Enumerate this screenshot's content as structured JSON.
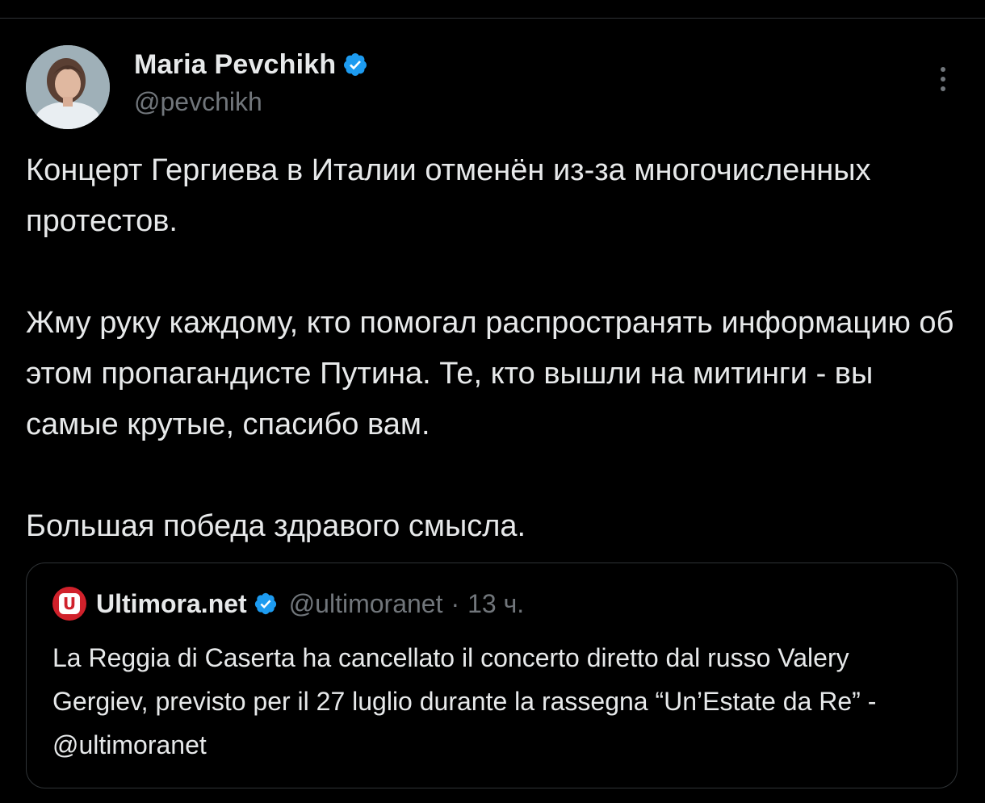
{
  "author": {
    "name": "Maria Pevchikh",
    "handle": "@pevchikh",
    "verified": true
  },
  "tweet": {
    "paragraphs": [
      "Концерт Гергиева в Италии отменён из-за многочисленных протестов.",
      "Жму руку каждому, кто помогал распространять информацию об этом пропагандисте Путина. Те, кто вышли на митинги - вы самые крутые, спасибо вам.",
      "Большая победа здравого смысла."
    ]
  },
  "quoted_tweet": {
    "name": "Ultimora.net",
    "handle": "@ultimoranet",
    "separator": "·",
    "time": "13 ч.",
    "verified": true,
    "text": "La Reggia di Caserta ha cancellato il concerto diretto dal russo Valery Gergiev, previsto per il 27 luglio durante la rassegna “Un’Estate da Re” - @ultimoranet",
    "avatar_glyph": "U"
  },
  "colors": {
    "background": "#000000",
    "text_primary": "#e7e9ea",
    "text_secondary": "#71767b",
    "verified_blue": "#1d9bf0",
    "border": "#2f3336",
    "quote_avatar_red": "#d0212b"
  },
  "icons": {
    "verified": "verified-badge-icon",
    "more": "more-vertical-icon"
  }
}
